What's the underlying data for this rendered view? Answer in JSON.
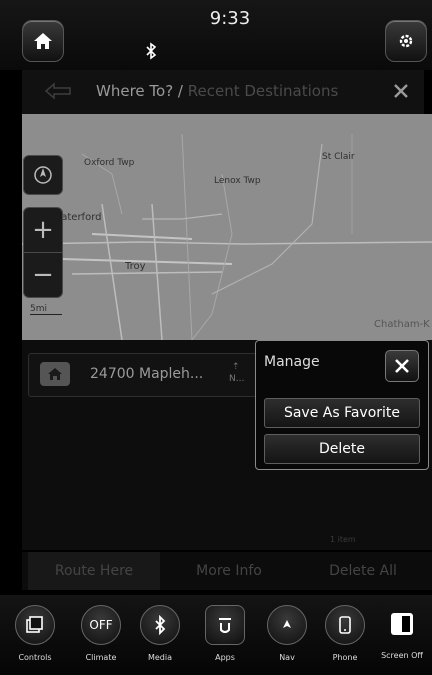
{
  "status_bar": {
    "time": "9:33",
    "home_icon": "home-icon",
    "settings_icon": "gear-icon",
    "bluetooth_icon": "bluetooth-icon"
  },
  "title_bar": {
    "title": "Where To? /",
    "subtitle": "Recent Destinations",
    "back_icon": "back-arrow-icon",
    "close_icon": "close-icon"
  },
  "map": {
    "labels": [
      "Oxford Twp",
      "Lenox Twp",
      "St Clair",
      "Waterford",
      "Troy",
      "Chatham-K"
    ],
    "scale_label": "5mi",
    "controls": [
      "compass-icon",
      "zoom-in-icon",
      "zoom-out-icon"
    ]
  },
  "recent_list": {
    "items": [
      {
        "label": "24700 Mapleh...",
        "distance": "N...",
        "icon": "home-icon"
      }
    ],
    "count_label": "1 item"
  },
  "manage_popup": {
    "title": "Manage",
    "save_label": "Save As Favorite",
    "delete_label": "Delete"
  },
  "actions": {
    "route_here": "Route Here",
    "more_info": "More Info",
    "delete_all": "Delete All"
  },
  "dock": {
    "items": [
      {
        "label": "Controls",
        "icon": "controls-icon"
      },
      {
        "label": "Climate",
        "icon": "climate-off-icon",
        "text": "OFF"
      },
      {
        "label": "Media",
        "icon": "bluetooth-icon"
      },
      {
        "label": "Apps",
        "icon": "apps-icon"
      },
      {
        "label": "Nav",
        "icon": "compass-icon"
      },
      {
        "label": "Phone",
        "icon": "phone-icon"
      },
      {
        "label": "Screen Off",
        "icon": "screen-off-icon"
      }
    ]
  }
}
